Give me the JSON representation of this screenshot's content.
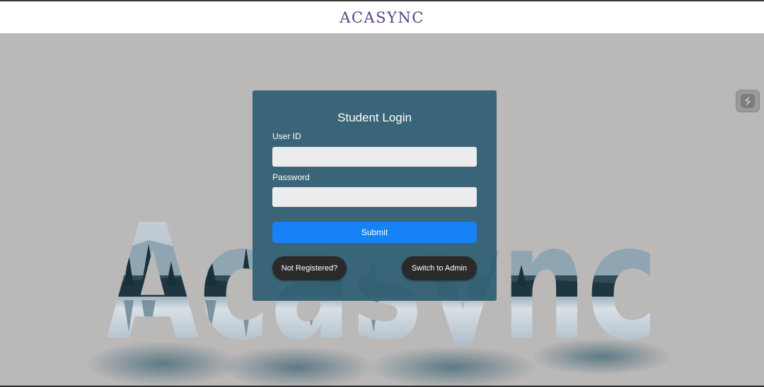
{
  "header": {
    "brand": "ACASYNC"
  },
  "background": {
    "art_text": "Acasync",
    "icon": "landscape-lettering"
  },
  "login": {
    "title": "Student Login",
    "user_id_label": "User ID",
    "user_id_value": "",
    "password_label": "Password",
    "password_value": "",
    "submit_label": "Submit",
    "not_registered_label": "Not Registered?",
    "switch_admin_label": "Switch to Admin"
  },
  "floating_widget": {
    "icon": "s-logo-icon"
  },
  "colors": {
    "background": "#bbb8b8",
    "brand": "#5b3f86",
    "card": "#346276",
    "submit": "#1782f7",
    "pill": "#2a2a2a",
    "input": "#ececec"
  }
}
